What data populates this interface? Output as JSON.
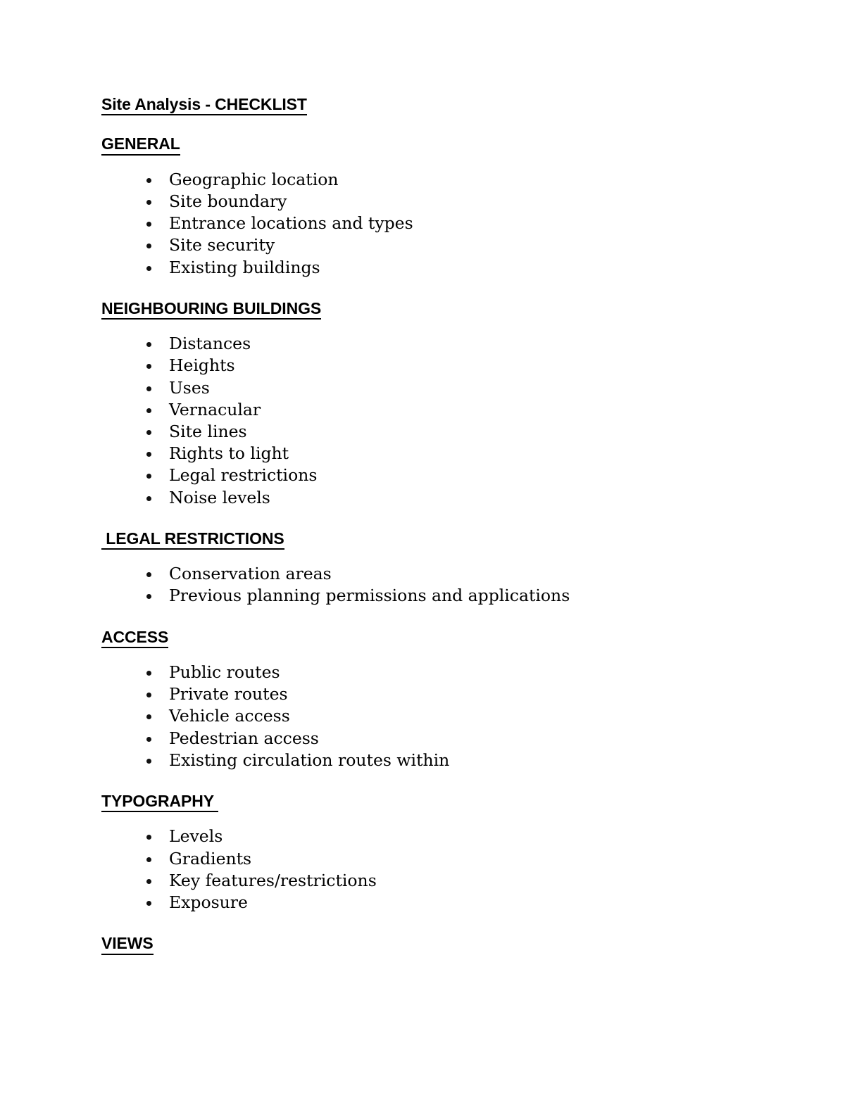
{
  "document": {
    "title": "Site Analysis - CHECKLIST",
    "sections": [
      {
        "heading": "GENERAL",
        "items": [
          "Geographic location",
          "Site boundary",
          "Entrance locations and types",
          "Site security",
          "Existing buildings"
        ]
      },
      {
        "heading": "NEIGHBOURING BUILDINGS",
        "items": [
          "Distances",
          "Heights",
          "Uses",
          "Vernacular",
          "Site lines",
          "Rights to light",
          "Legal restrictions",
          "Noise levels"
        ]
      },
      {
        "heading": " LEGAL RESTRICTIONS",
        "items": [
          "Conservation areas",
          "Previous planning permissions and applications"
        ]
      },
      {
        "heading": "ACCESS",
        "items": [
          "Public routes",
          "Private routes",
          "Vehicle access",
          "Pedestrian access",
          "Existing circulation routes within"
        ]
      },
      {
        "heading": "TYPOGRAPHY ",
        "items": [
          "Levels",
          "Gradients",
          "Key features/restrictions",
          "Exposure"
        ]
      },
      {
        "heading": "VIEWS",
        "items": []
      }
    ],
    "bullet_glyph": "bullet-dot",
    "text_color": "#000000",
    "page_background": "#ffffff"
  }
}
